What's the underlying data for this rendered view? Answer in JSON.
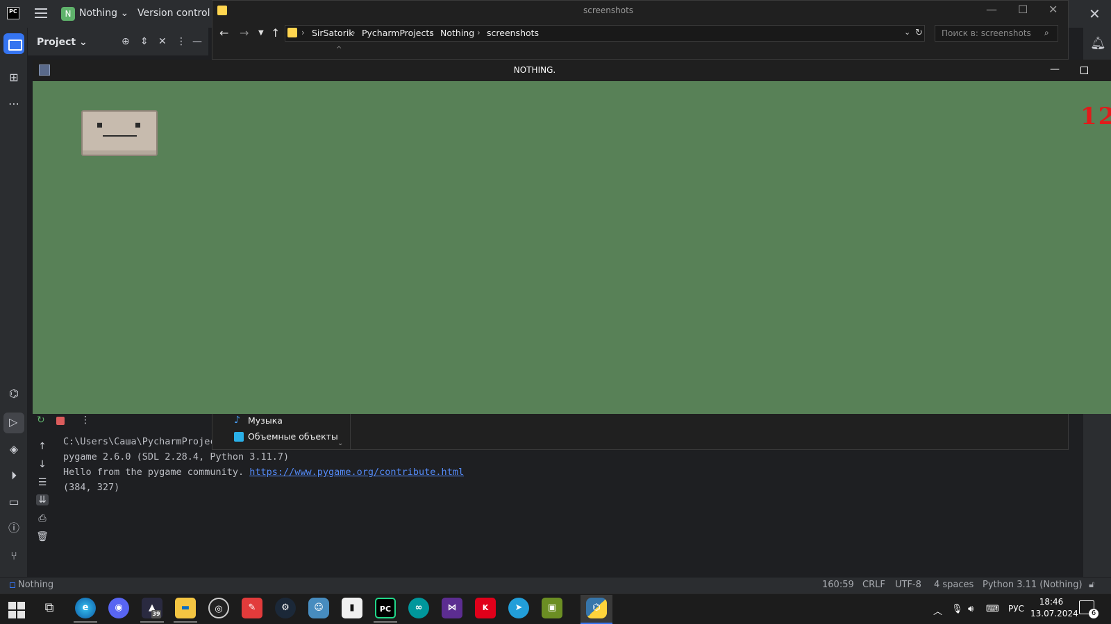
{
  "ide": {
    "logo": "PC",
    "project_badge": "N",
    "project_name": "Nothing",
    "vcs_label": "Version control",
    "project_panel_title": "Project",
    "run_console": {
      "line1": "C:\\Users\\Саша\\PycharmProjec",
      "line2": "pygame 2.6.0 (SDL 2.28.4, Python 3.11.7)",
      "line3_prefix": "Hello from the pygame community. ",
      "line3_link": "https://www.pygame.org/contribute.html",
      "line4": "(384, 327)"
    },
    "status_bar": {
      "project": "Nothing",
      "caret": "160:59",
      "line_sep": "CRLF",
      "encoding": "UTF-8",
      "indent": "4 spaces",
      "interpreter": "Python 3.11 (Nothing)"
    }
  },
  "explorer": {
    "title": "screenshots",
    "breadcrumbs": [
      "SirSatorik",
      "PycharmProjects",
      "Nothing",
      "screenshots"
    ],
    "search_placeholder": "Поиск в: screenshots",
    "nav_items": [
      "Музыка",
      "Объемные объекты"
    ]
  },
  "game": {
    "title": "NOTHING.",
    "score": "12",
    "colors": {
      "background": "#588157",
      "score": "#e01b1b",
      "box": "#c7bbae"
    }
  },
  "taskbar": {
    "apps": [
      "edge",
      "discord",
      "blender",
      "file-explorer",
      "obs",
      "sprite-editor",
      "steam",
      "godot",
      "twitch",
      "pycharm",
      "arduino",
      "visual-studio",
      "kaspersky",
      "telegram",
      "minecraft",
      "python"
    ],
    "blender_badge": "39",
    "lang": "РУС",
    "time": "18:46",
    "date": "13.07.2024",
    "notifications": "6"
  }
}
